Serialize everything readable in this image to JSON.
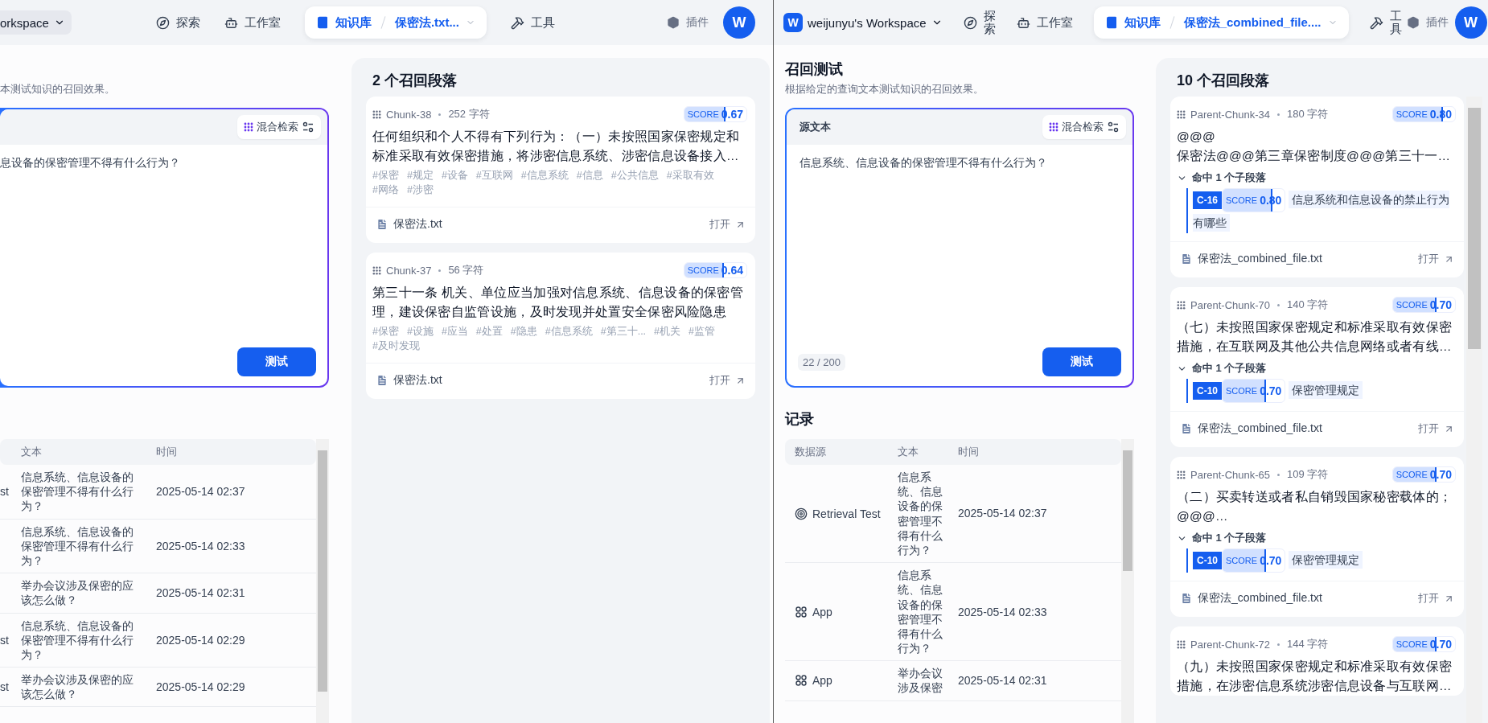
{
  "panes": [
    {
      "header": {
        "workspace": {
          "name": "orkspace",
          "highlighted": true
        },
        "nav": [
          {
            "kind": "link",
            "label": "探索",
            "selected": false
          },
          {
            "kind": "link",
            "label": "工作室",
            "selected": false
          },
          {
            "kind": "breadcrumb",
            "section": "知识库",
            "document": "保密法.txt...",
            "selected": true
          },
          {
            "kind": "link",
            "label": "工具",
            "selected": false
          }
        ],
        "plugins": "插件",
        "avatar": "W"
      },
      "retrieval": {
        "description": "本测试知识的召回效果。",
        "query": {
          "mode": "混合检索",
          "text": "息设备的保密管理不得有什么行为？",
          "submit": "测试"
        },
        "records": {
          "columns": [
            "文本",
            "时间"
          ],
          "rows": [
            {
              "source": {
                "label": "st"
              },
              "text": "信息系统、信息设备的保密管理不得有什么行为？",
              "time": "2025-05-14 02:37"
            },
            {
              "text": "信息系统、信息设备的保密管理不得有什么行为？",
              "time": "2025-05-14 02:33"
            },
            {
              "text": "举办会议涉及保密的应该怎么做？",
              "time": "2025-05-14 02:31"
            },
            {
              "source": {
                "label": "st"
              },
              "text": "信息系统、信息设备的保密管理不得有什么行为？",
              "time": "2025-05-14 02:29"
            },
            {
              "source": {
                "label": "st"
              },
              "text": "举办会议涉及保密的应该怎么做？",
              "time": "2025-05-14 02:29"
            }
          ]
        }
      },
      "results": {
        "title": "2 个召回段落",
        "cards": [
          {
            "chunk": "Chunk-38",
            "chars": "252 字符",
            "score": {
              "label": "SCORE",
              "value": "0.67",
              "level": 0.67
            },
            "content": "任何组织和个人不得有下列行为：（一）未按照国家保密规定和标准采取有效保密措施，将涉密信息系统、涉密信息设备接入…",
            "tags": [
              "#保密",
              "#规定",
              "#设备",
              "#互联网",
              "#信息系统",
              "#信息",
              "#公共信息",
              "#采取有效",
              "#网络",
              "#涉密"
            ],
            "file": "保密法.txt",
            "open": "打开"
          },
          {
            "chunk": "Chunk-37",
            "chars": "56 字符",
            "score": {
              "label": "SCORE",
              "value": "0.64",
              "level": 0.64
            },
            "content": "第三十一条 机关、单位应当加强对信息系统、信息设备的保密管理，建设保密自监管设施，及时发现并处置安全保密风险隐患",
            "tags": [
              "#保密",
              "#设施",
              "#应当",
              "#处置",
              "#隐患",
              "#信息系统",
              "#第三十...",
              "#机关",
              "#监管",
              "#及时发现"
            ],
            "file": "保密法.txt",
            "open": "打开"
          }
        ]
      }
    },
    {
      "header": {
        "workspace": {
          "logo": "W",
          "name": "weijunyu's Workspace",
          "highlighted": false
        },
        "nav": [
          {
            "kind": "link",
            "label": "探索",
            "selected": false
          },
          {
            "kind": "link",
            "label": "工作室",
            "selected": false
          },
          {
            "kind": "breadcrumb",
            "section": "知识库",
            "document": "保密法_combined_file....",
            "selected": true
          },
          {
            "kind": "link",
            "label": "工具",
            "selected": false
          }
        ],
        "plugins": "插件",
        "avatar": "W"
      },
      "retrieval": {
        "title": "召回测试",
        "description": "根据给定的查询文本测试知识的召回效果。",
        "query": {
          "label": "源文本",
          "mode": "混合检索",
          "text": "信息系统、信息设备的保密管理不得有什么行为？",
          "counter": "22 / 200",
          "submit": "测试"
        },
        "records": {
          "title": "记录",
          "columns": [
            "数据源",
            "文本",
            "时间"
          ],
          "rows": [
            {
              "source": {
                "kind": "retrieval_test",
                "label": "Retrieval Test"
              },
              "text": "信息系统、信息设备的保密管理不得有什么行为？",
              "time": "2025-05-14 02:37"
            },
            {
              "source": {
                "kind": "app",
                "label": "App"
              },
              "text": "信息系统、信息设备的保密管理不得有什么行为？",
              "time": "2025-05-14 02:33"
            },
            {
              "source": {
                "kind": "app",
                "label": "App"
              },
              "text": "举办会议涉及保密",
              "time": "2025-05-14 02:31"
            }
          ]
        }
      },
      "results": {
        "title": "10 个召回段落",
        "cards": [
          {
            "chunk": "Parent-Chunk-34",
            "chars": "180 字符",
            "score": {
              "label": "SCORE",
              "value": "0.80",
              "level": 0.8
            },
            "content": "@@@\n保密法@@@第三章保密制度@@@第三十一…",
            "hits": {
              "label": "命中 1 个子段落",
              "expanded": true,
              "items": [
                {
                  "id": "C-16",
                  "score": {
                    "label": "SCORE",
                    "value": "0.80",
                    "level": 0.8
                  },
                  "text": "信息系统和信息设备的禁止行为有哪些"
                }
              ]
            },
            "file": "保密法_combined_file.txt",
            "open": "打开"
          },
          {
            "chunk": "Parent-Chunk-70",
            "chars": "140 字符",
            "score": {
              "label": "SCORE",
              "value": "0.70",
              "level": 0.7
            },
            "content": "（七）未按照国家保密规定和标准采取有效保密措施，在互联网及其他公共信息网络或者有线…",
            "hits": {
              "label": "命中 1 个子段落",
              "expanded": true,
              "items": [
                {
                  "id": "C-10",
                  "score": {
                    "label": "SCORE",
                    "value": "0.70",
                    "level": 0.7
                  },
                  "text": "保密管理规定"
                }
              ]
            },
            "file": "保密法_combined_file.txt",
            "open": "打开"
          },
          {
            "chunk": "Parent-Chunk-65",
            "chars": "109 字符",
            "score": {
              "label": "SCORE",
              "value": "0.70",
              "level": 0.7
            },
            "content": "（二）买卖转送或者私自销毁国家秘密载体的；\n@@@…",
            "hits": {
              "label": "命中 1 个子段落",
              "expanded": true,
              "items": [
                {
                  "id": "C-10",
                  "score": {
                    "label": "SCORE",
                    "value": "0.70",
                    "level": 0.7
                  },
                  "text": "保密管理规定"
                }
              ]
            },
            "file": "保密法_combined_file.txt",
            "open": "打开"
          },
          {
            "chunk": "Parent-Chunk-72",
            "chars": "144 字符",
            "score": {
              "label": "SCORE",
              "value": "0.70",
              "level": 0.7
            },
            "content": "（九）未按照国家保密规定和标准采取有效保密措施，在涉密信息系统涉密信息设备与互联网…"
          }
        ]
      }
    }
  ]
}
